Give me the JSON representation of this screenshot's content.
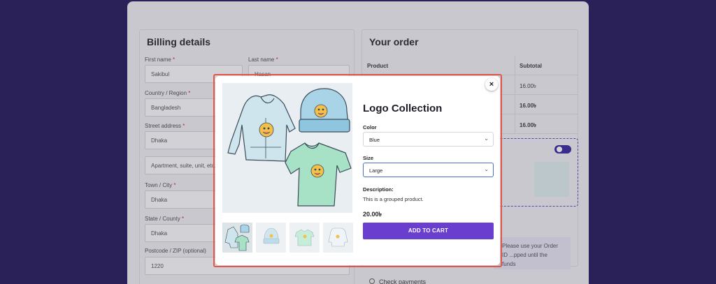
{
  "billing": {
    "title": "Billing details",
    "first_name_label": "First name",
    "first_name_value": "Sakibul",
    "last_name_label": "Last name",
    "last_name_value": "Hasan",
    "country_label": "Country / Region",
    "country_value": "Bangladesh",
    "street_label": "Street address",
    "street_value": "Dhaka",
    "street2_placeholder": "Apartment, suite, unit, etc.",
    "city_label": "Town / City",
    "city_value": "Dhaka",
    "state_label": "State / County",
    "state_value": "Dhaka",
    "postcode_label": "Postcode / ZIP (optional)",
    "postcode_value": "1220",
    "required_mark": "*"
  },
  "order": {
    "title": "Your order",
    "col_product": "Product",
    "col_subtotal": "Subtotal",
    "rows": [
      "16.00৳",
      "16.00৳",
      "16.00৳"
    ],
    "notice_text": "Please use your Order ID ...pped until the funds",
    "check_payments": "Check payments"
  },
  "modal": {
    "close_label": "×",
    "product_title": "Logo Collection",
    "color_label": "Color",
    "color_value": "Blue",
    "size_label": "Size",
    "size_value": "Large",
    "description_label": "Description:",
    "description_text": "This is a grouped product.",
    "price": "20.00৳",
    "add_to_cart": "ADD TO CART"
  },
  "colors": {
    "accent": "#6a3fd0",
    "background": "#2a2158",
    "highlight": "#e2574c"
  }
}
